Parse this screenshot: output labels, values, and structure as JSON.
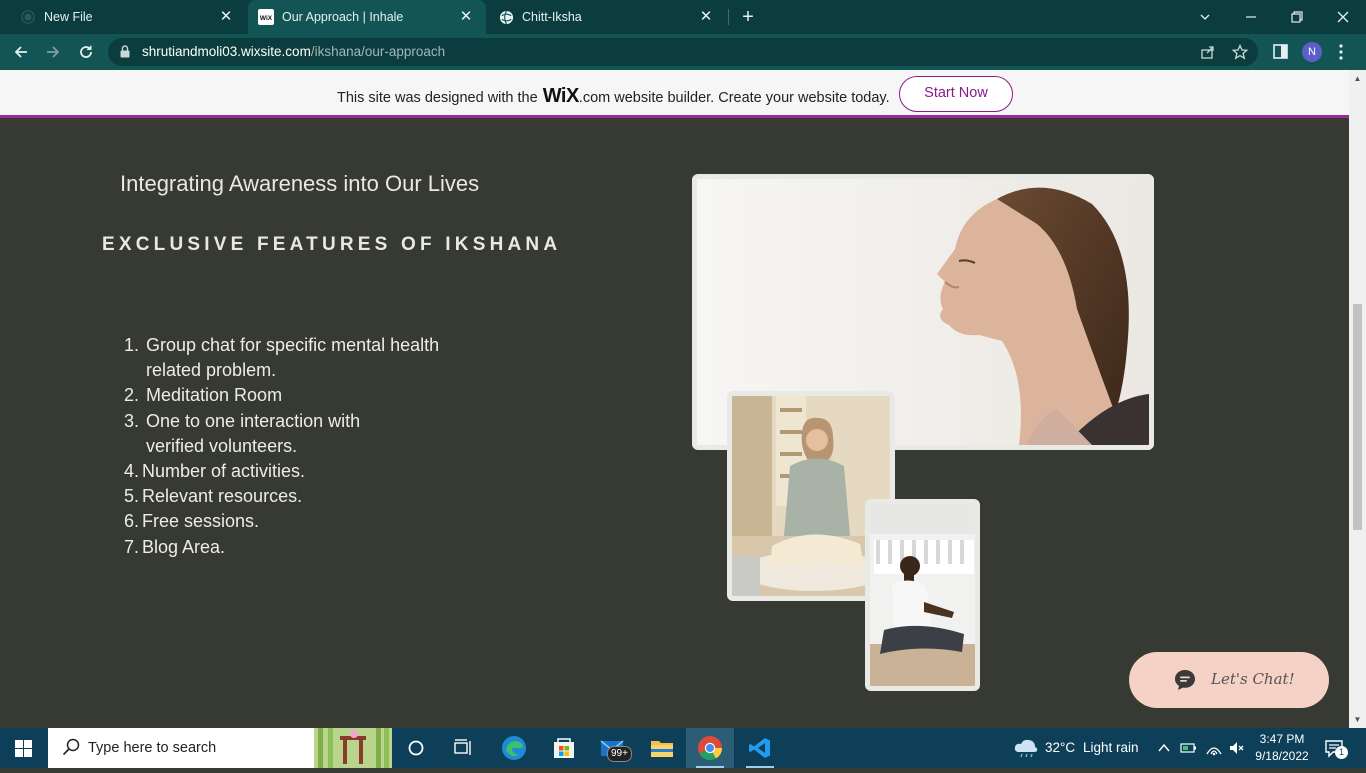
{
  "browser": {
    "tabs": [
      {
        "title": "New File",
        "icon": "github-icon",
        "active": false
      },
      {
        "title": "Our Approach | Inhale",
        "icon": "wix-icon",
        "active": true
      },
      {
        "title": "Chitt-Iksha",
        "icon": "globe-icon",
        "active": false
      }
    ],
    "tab_close_glyph": "✕",
    "new_tab_glyph": "+",
    "url_host": "shrutiandmoli03.wixsite.com",
    "url_path": "/ikshana/our-approach",
    "profile_initial": "N"
  },
  "wix_banner": {
    "text_before": "This site was designed with the",
    "logo": "WiX",
    "text_after": ".com website builder. Create your website today.",
    "button": "Start Now",
    "accent_color": "#9a2b9e"
  },
  "page": {
    "subtitle": "Integrating Awareness into Our Lives",
    "heading": "EXCLUSIVE FEATURES OF IKSHANA",
    "features": [
      {
        "num": "1.",
        "text": "Group chat for specific mental health related problem."
      },
      {
        "num": "2.",
        "text": "Meditation Room"
      },
      {
        "num": "3.",
        "text": "One to one interaction with verified volunteers."
      },
      {
        "num": "4.",
        "text": "Number of activities."
      },
      {
        "num": "5.",
        "text": "Relevant resources."
      },
      {
        "num": "6.",
        "text": "Free sessions."
      },
      {
        "num": "7.",
        "text": "Blog Area."
      }
    ],
    "chat_button": "Let's Chat!",
    "background_color": "#373a32"
  },
  "taskbar": {
    "search_placeholder": "Type here to search",
    "mail_badge": "99+",
    "weather_temp": "32°C",
    "weather_text": "Light rain",
    "time": "3:47 PM",
    "date": "9/18/2022",
    "notification_count": "1"
  }
}
